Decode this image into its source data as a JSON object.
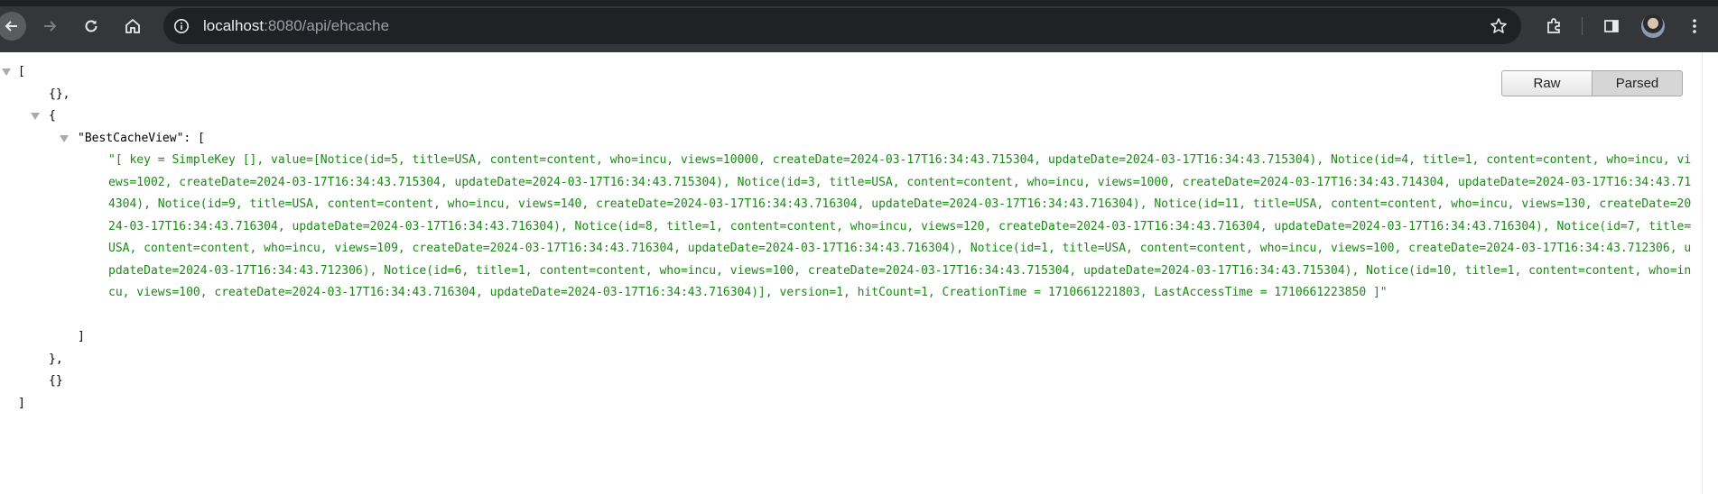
{
  "browser": {
    "url_host": "localhost",
    "url_rest": ":8080/api/ehcache"
  },
  "viewer": {
    "raw_label": "Raw",
    "parsed_label": "Parsed"
  },
  "json": {
    "open_bracket": "[",
    "empty_obj_1": "{},",
    "open_brace": "{",
    "key_line": "\"BestCacheView\": [",
    "value": "\"[ key = SimpleKey [], value=[Notice(id=5, title=USA, content=content, who=incu, views=10000, createDate=2024-03-17T16:34:43.715304, updateDate=2024-03-17T16:34:43.715304), Notice(id=4, title=1, content=content, who=incu, views=1002, createDate=2024-03-17T16:34:43.715304, updateDate=2024-03-17T16:34:43.715304), Notice(id=3, title=USA, content=content, who=incu, views=1000, createDate=2024-03-17T16:34:43.714304, updateDate=2024-03-17T16:34:43.714304), Notice(id=9, title=USA, content=content, who=incu, views=140, createDate=2024-03-17T16:34:43.716304, updateDate=2024-03-17T16:34:43.716304), Notice(id=11, title=USA, content=content, who=incu, views=130, createDate=2024-03-17T16:34:43.716304, updateDate=2024-03-17T16:34:43.716304), Notice(id=8, title=1, content=content, who=incu, views=120, createDate=2024-03-17T16:34:43.716304, updateDate=2024-03-17T16:34:43.716304), Notice(id=7, title=USA, content=content, who=incu, views=109, createDate=2024-03-17T16:34:43.716304, updateDate=2024-03-17T16:34:43.716304), Notice(id=1, title=USA, content=content, who=incu, views=100, createDate=2024-03-17T16:34:43.712306, updateDate=2024-03-17T16:34:43.712306), Notice(id=6, title=1, content=content, who=incu, views=100, createDate=2024-03-17T16:34:43.715304, updateDate=2024-03-17T16:34:43.715304), Notice(id=10, title=1, content=content, who=incu, views=100, createDate=2024-03-17T16:34:43.716304, updateDate=2024-03-17T16:34:43.716304)], version=1, hitCount=1, CreationTime = 1710661221803, LastAccessTime = 1710661223850 ]\"",
    "close_inner_bracket": "]",
    "close_brace": "},",
    "empty_obj_2": "{}",
    "close_bracket": "]"
  }
}
